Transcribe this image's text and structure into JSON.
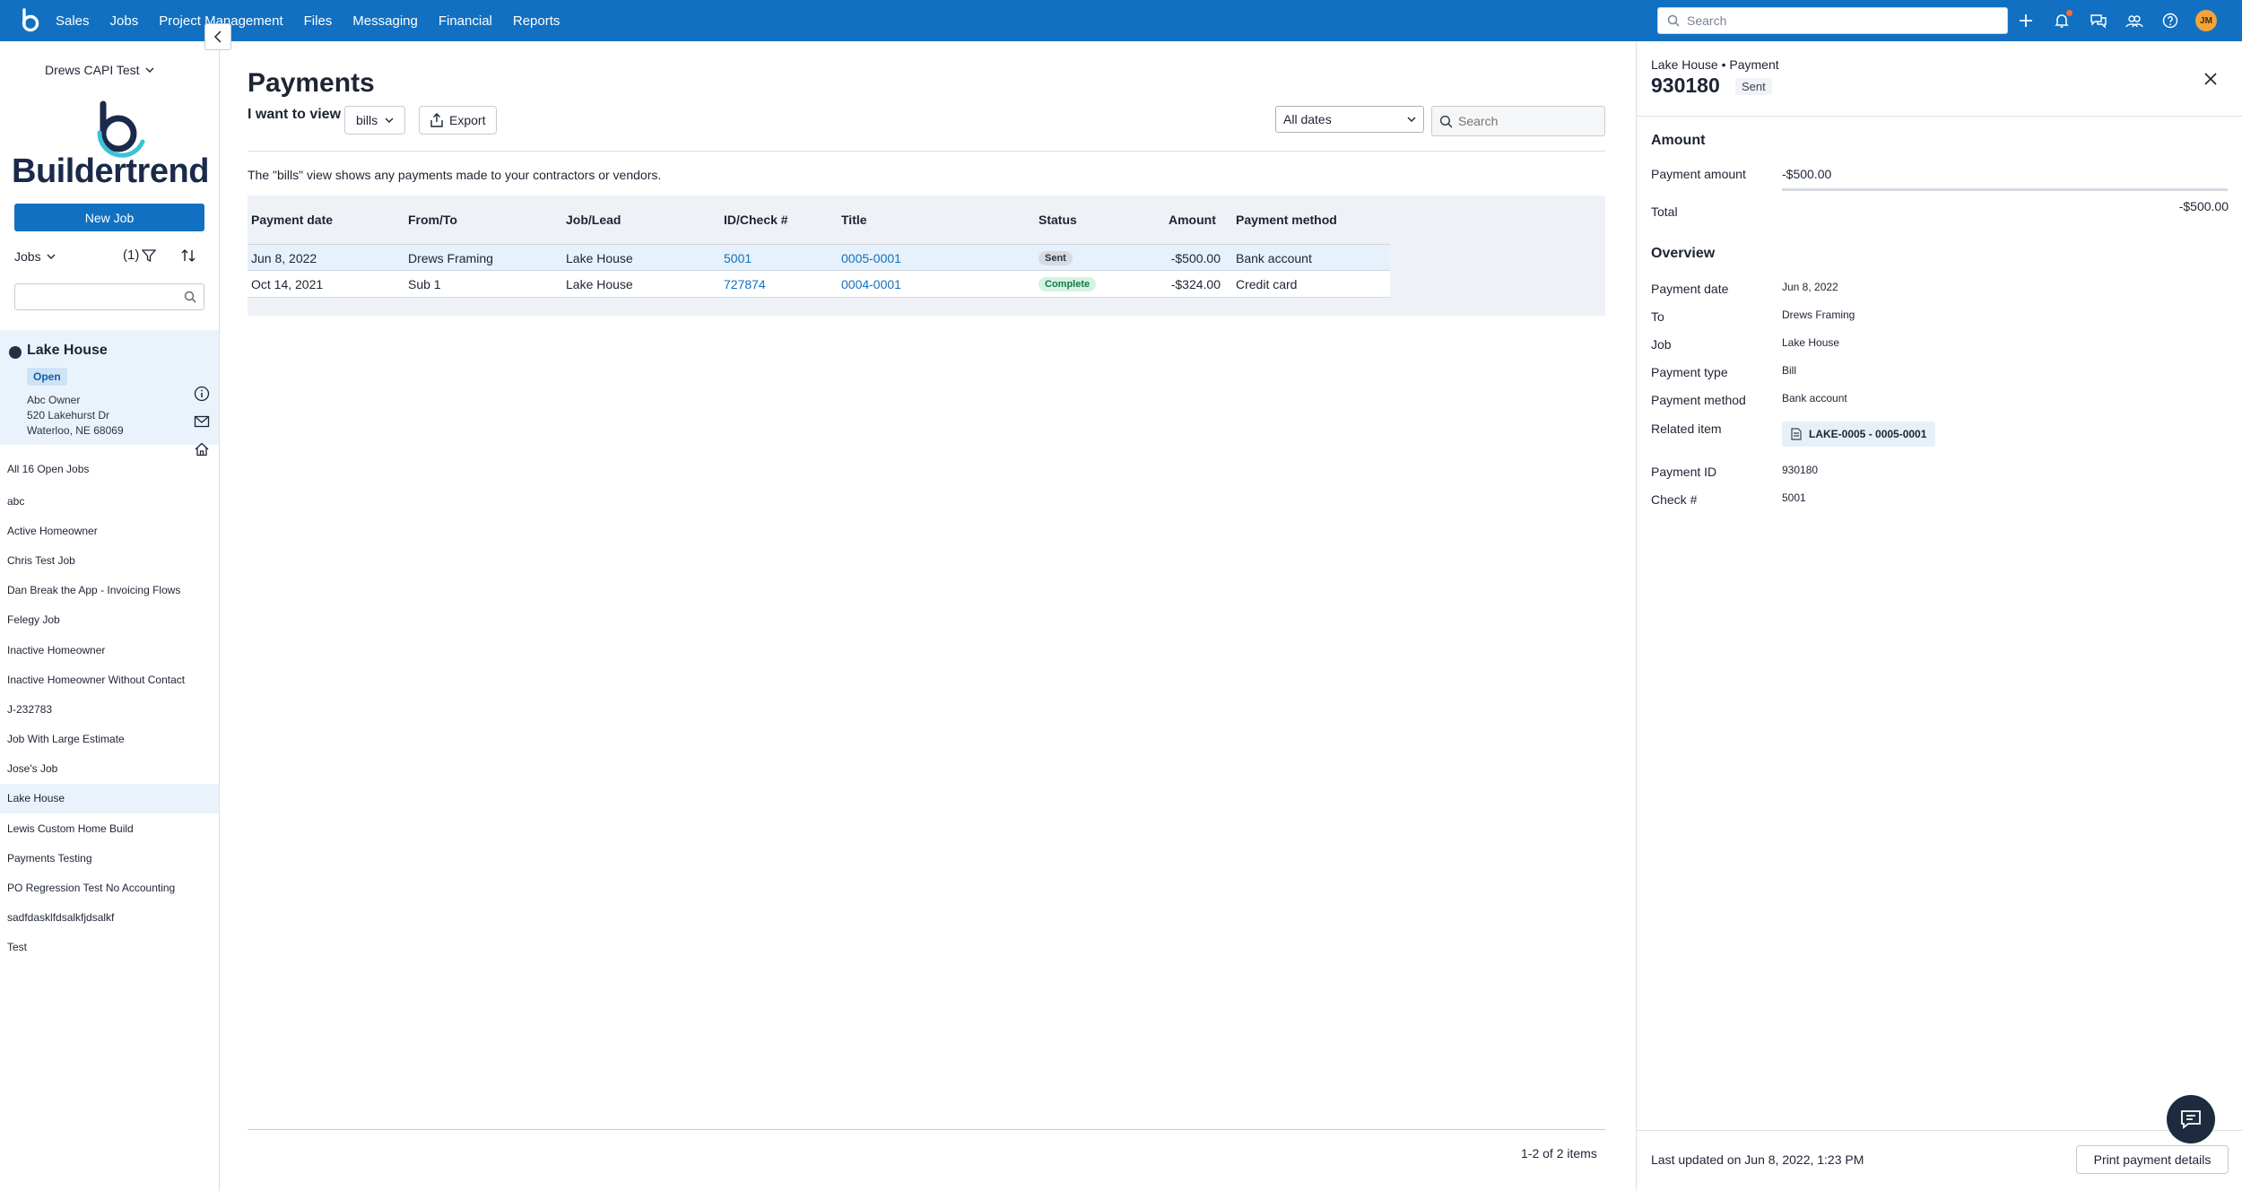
{
  "nav": {
    "links": [
      "Sales",
      "Jobs",
      "Project Management",
      "Files",
      "Messaging",
      "Financial",
      "Reports"
    ],
    "search_placeholder": "Search",
    "avatar_initials": "JM",
    "icons": [
      "plus-icon",
      "bell-icon",
      "chat-icon",
      "people-icon",
      "help-icon"
    ],
    "accent_color": "#1170c2"
  },
  "sidebar": {
    "account": "Drews CAPI Test",
    "brand": "Buildertrend",
    "new_job_label": "New Job",
    "jobs_dropdown": "Jobs",
    "filter_count": "(1)",
    "selected_job": {
      "name": "Lake House",
      "status": "Open",
      "owner": "Abc Owner",
      "street": "520 Lakehurst Dr",
      "city": "Waterloo, NE 68069"
    },
    "all_open_label": "All 16 Open Jobs",
    "jobs": [
      "abc",
      "Active Homeowner",
      "Chris Test Job",
      "Dan Break the App - Invoicing Flows",
      "Felegy Job",
      "Inactive Homeowner",
      "Inactive Homeowner Without Contact",
      "J-232783",
      "Job With Large Estimate",
      "Jose's Job",
      "Lake House",
      "Lewis Custom Home Build",
      "Payments Testing",
      "PO Regression Test No Accounting",
      "sadfdasklfdsalkfjdsalkf",
      "Test"
    ]
  },
  "main": {
    "title": "Payments",
    "i_want_to_view": "I want to view",
    "view_value": "bills",
    "export_label": "Export",
    "dates_value": "All dates",
    "search_placeholder": "Search",
    "description": "The \"bills\" view shows any payments made to your contractors or vendors.",
    "columns": [
      "Payment date",
      "From/To",
      "Job/Lead",
      "ID/Check #",
      "Title",
      "Status",
      "Amount",
      "Payment method"
    ],
    "rows": [
      {
        "date": "Jun 8, 2022",
        "from_to": "Drews Framing",
        "job": "Lake House",
        "id": "5001",
        "title": "0005-0001",
        "status": "Sent",
        "amount": "-$500.00",
        "method": "Bank account"
      },
      {
        "date": "Oct 14, 2021",
        "from_to": "Sub 1",
        "job": "Lake House",
        "id": "727874",
        "title": "0004-0001",
        "status": "Complete",
        "amount": "-$324.00",
        "method": "Credit card"
      }
    ],
    "paging": "1-2 of 2 items"
  },
  "panel": {
    "breadcrumb": "Lake House • Payment",
    "payment_id_title": "930180",
    "status": "Sent",
    "amount_section": "Amount",
    "payment_amount_label": "Payment amount",
    "payment_amount": "-$500.00",
    "total_label": "Total",
    "total": "-$500.00",
    "overview_section": "Overview",
    "fields": {
      "payment_date_label": "Payment date",
      "payment_date": "Jun 8, 2022",
      "to_label": "To",
      "to": "Drews Framing",
      "job_label": "Job",
      "job": "Lake House",
      "payment_type_label": "Payment type",
      "payment_type": "Bill",
      "payment_method_label": "Payment method",
      "payment_method": "Bank account",
      "related_item_label": "Related item",
      "related_item": "LAKE-0005 - 0005-0001",
      "payment_id_label": "Payment ID",
      "payment_id": "930180",
      "check_label": "Check #",
      "check": "5001"
    },
    "last_updated": "Last updated on Jun 8, 2022, 1:23 PM",
    "print_label": "Print payment details"
  }
}
